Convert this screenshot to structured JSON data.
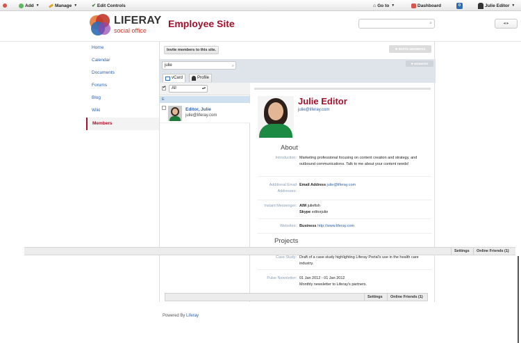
{
  "dockbar": {
    "add": "Add",
    "manage": "Manage",
    "edit_controls": "Edit Controls",
    "go_to": "Go to",
    "dashboard": "Dashboard",
    "notifications_count": "0",
    "user": "Julie Editor"
  },
  "header": {
    "logo_main": "LIFERAY",
    "logo_sub": "social office",
    "site_title": "Employee Site",
    "search_value": ""
  },
  "nav": {
    "items": [
      "Home",
      "Calendar",
      "Documents",
      "Forums",
      "Blog",
      "Wiki",
      "Members"
    ],
    "active": "Members"
  },
  "members": {
    "invite_button": "Invite members to this site.",
    "invite_members_button": "INVITE MEMBERS",
    "members_button": "MEMBERS",
    "search_value": "julie",
    "tabs": [
      "vCard",
      "Profile"
    ],
    "filter": "All",
    "letter": "E",
    "list": [
      {
        "name": "Editor, Julie",
        "email": "julie@liferay.com"
      }
    ]
  },
  "profile": {
    "name": "Julie Editor",
    "email": "julie@liferay.com",
    "about_heading": "About",
    "introduction_label": "Introduction:",
    "introduction": "Marketing professional focusing on content creation and strategy, and outbound communications. Talk to me about your content needs!",
    "additional_email_label": "Additional Email Addresses:",
    "email_address_label": "Email Address",
    "email_address": "julie@liferay.com",
    "instant_messenger_label": "Instant Messenger:",
    "aim_label": "AIM",
    "aim": "juliefish",
    "skype_label": "Skype",
    "skype": "editorjulie",
    "websites_label": "Websites:",
    "business_label": "Business",
    "business_url": "http://www.liferay.com",
    "projects_heading": "Projects",
    "case_study_label": "Case Study:",
    "case_study": "Draft of a case study highlighting Liferay Portal's use in the health care industry.",
    "pulse_label": "Pulse Newsletter:",
    "pulse_dates": "01 Jan 2012 - 01 Jan 2012",
    "pulse": "Monthly newsletter to Liferay's partners."
  },
  "chat": {
    "settings": "Settings",
    "online_friends": "Online Friends (1)"
  },
  "footer": {
    "powered_by": "Powered By",
    "liferay": "Liferay"
  },
  "colors": {
    "brand_red": "#a3102b",
    "link_blue": "#2b5fa8"
  }
}
